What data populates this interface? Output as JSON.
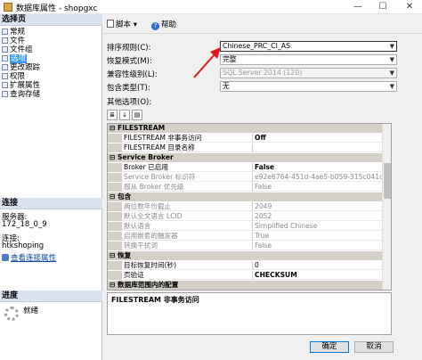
{
  "window": {
    "title": "数据库属性 - shopgxc",
    "min": "—",
    "max": "☐",
    "close": "✕"
  },
  "left": {
    "select_page_header": "选择页",
    "nav": [
      {
        "label": "常规",
        "selected": false
      },
      {
        "label": "文件",
        "selected": false
      },
      {
        "label": "文件组",
        "selected": false
      },
      {
        "label": "选项",
        "selected": true
      },
      {
        "label": "更改跟踪",
        "selected": false
      },
      {
        "label": "权限",
        "selected": false
      },
      {
        "label": "扩展属性",
        "selected": false
      },
      {
        "label": "查询存储",
        "selected": false
      }
    ],
    "connection_header": "连接",
    "server_label": "服务器:",
    "server_value": "172_18_0_9",
    "conn_label": "连接:",
    "conn_value": "htkshoping",
    "view_link": "查看连接属性",
    "progress_header": "进度",
    "status": "就绪"
  },
  "toolbar": {
    "script": "脚本",
    "script_arrow": "▾",
    "help": "帮助"
  },
  "form": {
    "collation_label": "排序规则(C):",
    "collation_value": "Chinese_PRC_CI_AS",
    "recovery_label": "恢复模式(M):",
    "recovery_value": "完整",
    "compat_label": "兼容性级别(L):",
    "compat_value": "SQL Server 2014 (120)",
    "containment_label": "包含类型(T):",
    "containment_value": "无",
    "other_label": "其他选项(O):"
  },
  "grid": {
    "rows": [
      {
        "kind": "cat",
        "name": "FILESTREAM"
      },
      {
        "kind": "prop",
        "name": "FILESTREAM 非事务访问",
        "value": "Off",
        "bold": true
      },
      {
        "kind": "prop",
        "name": "FILESTREAM 目录名称",
        "value": ""
      },
      {
        "kind": "cat",
        "name": "Service Broker"
      },
      {
        "kind": "prop",
        "name": "Broker 已启用",
        "value": "False",
        "bold": true
      },
      {
        "kind": "prop",
        "name": "Service Broker 标识符",
        "value": "e92e6764-451d-4ae5-b059-315c041cd706",
        "dim": true
      },
      {
        "kind": "prop",
        "name": "服从 Broker 优先级",
        "value": "False",
        "dim": true
      },
      {
        "kind": "cat",
        "name": "包含"
      },
      {
        "kind": "prop",
        "name": "两位数年份截止",
        "value": "2049",
        "dim": true
      },
      {
        "kind": "prop",
        "name": "默认全文语言 LCID",
        "value": "2052",
        "dim": true
      },
      {
        "kind": "prop",
        "name": "默认语言",
        "value": "Simplified Chinese",
        "dim": true
      },
      {
        "kind": "prop",
        "name": "启用嵌套的触发器",
        "value": "True",
        "dim": true
      },
      {
        "kind": "prop",
        "name": "转换干扰词",
        "value": "False",
        "dim": true
      },
      {
        "kind": "cat",
        "name": "恢复"
      },
      {
        "kind": "prop",
        "name": "目标恢复时间(秒)",
        "value": "0"
      },
      {
        "kind": "prop",
        "name": "页验证",
        "value": "CHECKSUM",
        "bold": true
      },
      {
        "kind": "cat",
        "name": "数据库范围内的配置"
      }
    ]
  },
  "description": {
    "title": "FILESTREAM 非事务访问"
  },
  "buttons": {
    "ok": "确定",
    "cancel": "取消"
  },
  "colors": {
    "selection": "#3399ff",
    "annotation_arrow": "#e8141a",
    "category_bg": "#d4d0c8"
  }
}
